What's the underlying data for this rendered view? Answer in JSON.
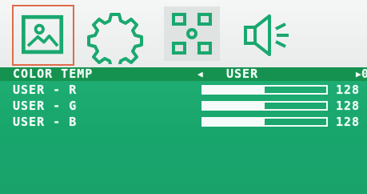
{
  "tabs": [
    {
      "name": "picture",
      "icon": "picture-icon",
      "selected": true
    },
    {
      "name": "adjust",
      "icon": "gear-icon",
      "selected": false
    },
    {
      "name": "position",
      "icon": "position-icon",
      "selected": false
    },
    {
      "name": "audio",
      "icon": "speaker-icon",
      "selected": false
    }
  ],
  "colors": {
    "accent": "#1aa86f",
    "highlight": "#15924f",
    "selection": "#e06a4a"
  },
  "menu": {
    "color_temp": {
      "label": "COLOR TEMP",
      "value": "USER",
      "right_text": "0"
    },
    "rows": [
      {
        "label": "USER - R",
        "value_text": "128",
        "level": 0.5
      },
      {
        "label": "USER - G",
        "value_text": "128",
        "level": 0.5
      },
      {
        "label": "USER - B",
        "value_text": "128",
        "level": 0.5
      }
    ]
  }
}
